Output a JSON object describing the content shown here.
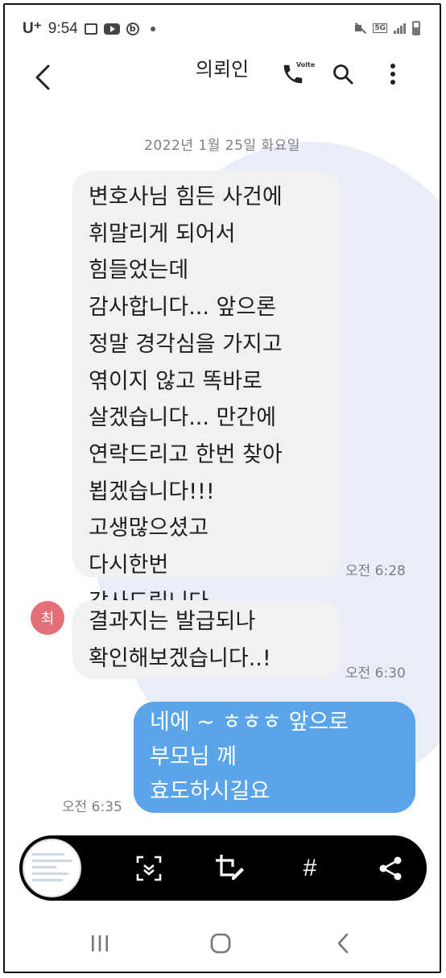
{
  "status_bar": {
    "carrier": "U⁺",
    "time": "9:54",
    "network": "5G"
  },
  "header": {
    "title": "의뢰인",
    "call_badge": "Volte",
    "icons": [
      "back-arrow-icon",
      "phone-icon",
      "search-icon",
      "more-vertical-icon"
    ]
  },
  "conversation": {
    "date": "2022년 1월 25일 화요일",
    "messages": [
      {
        "direction": "incoming",
        "text": "변호사님 힘든 사건에\n휘말리게 되어서\n힘들었는데\n감사합니다... 앞으론\n정말 경각심을 가지고\n엮이지 않고 똑바로\n살겠습니다... 만간에\n연락드리고 한번 찾아\n뵙겠습니다!!!\n고생많으셨고\n다시한번\n감사드립니다.",
        "time": "오전 6:28"
      },
      {
        "direction": "incoming",
        "sender_initial": "최",
        "text": "결과지는 발급되나\n확인해보겠습니다..!",
        "time": "오전 6:30"
      },
      {
        "direction": "outgoing",
        "text": "네에 ~ ㅎㅎㅎ 앞으로\n부모님 께\n효도하시길요",
        "time": "오전 6:35"
      }
    ]
  },
  "screenshot_toolbar": {
    "tag_label": "#",
    "icons": [
      "scroll-capture-icon",
      "crop-edit-icon",
      "hashtag-icon",
      "share-icon"
    ]
  },
  "navigation_bar": {
    "icons": [
      "recent-apps-icon",
      "home-icon",
      "back-icon"
    ]
  },
  "colors": {
    "outgoing_bubble": "#5aa5ea",
    "incoming_bubble": "#f1f1f1",
    "avatar": "#e56f78",
    "background_blob": "#e9edf8",
    "toolbar": "#000000"
  }
}
